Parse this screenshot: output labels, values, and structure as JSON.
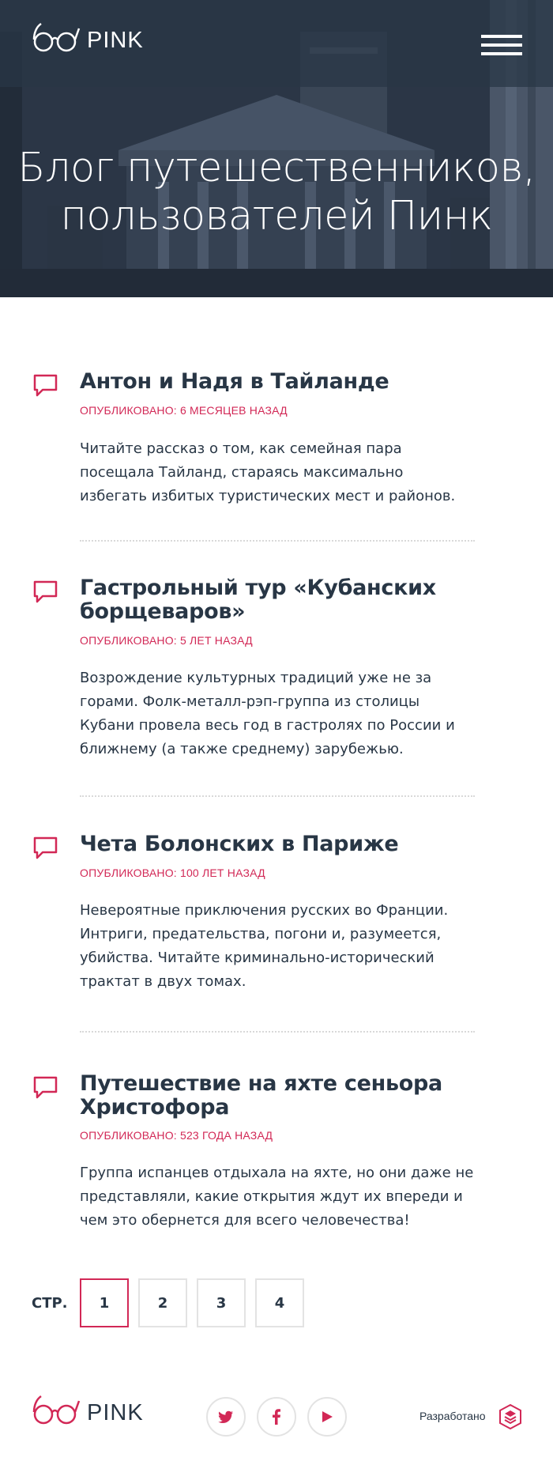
{
  "header": {
    "logo_text": "PINK",
    "title_line1": "Блог путешественников,",
    "title_line2": "пользователей Пинк"
  },
  "posts": [
    {
      "title": "Антон и Надя в Тайланде",
      "date": "ОПУБЛИКОВАНО: 6 МЕСЯЦЕВ НАЗАД",
      "text": "Читайте рассказ о том, как семейная пара посещала Тайланд, стараясь максимально избегать избитых туристических мест и районов."
    },
    {
      "title": "Гастрольный тур «Кубанских борщеваров»",
      "date": "ОПУБЛИКОВАНО: 5 ЛЕТ НАЗАД",
      "text": "Возрождение культурных традиций уже не за горами. Фолк-металл-рэп-группа из столицы Кубани провела весь год в гастролях по России и ближнему (а также среднему) зарубежью."
    },
    {
      "title": "Чета Болонских в Париже",
      "date": "ОПУБЛИКОВАНО: 100 ЛЕТ НАЗАД",
      "text": "Невероятные приключения русских во Франции. Интриги, предательства, погони и, разумеется, убийства. Читайте криминально-исторический трактат в двух томах."
    },
    {
      "title": "Путешествие на яхте сеньора Христофора",
      "date": "ОПУБЛИКОВАНО: 523 ГОДА НАЗАД",
      "text": "Группа испанцев отдыхала на яхте, но они даже не представляли, какие открытия ждут их впереди и чем это обернется для всего человечества!"
    }
  ],
  "pagination": {
    "label": "СТР.",
    "pages": [
      "1",
      "2",
      "3",
      "4"
    ],
    "current": "1"
  },
  "footer": {
    "logo_text": "PINK",
    "developer_label": "Разработано",
    "social": [
      "twitter-icon",
      "facebook-icon",
      "youtube-icon"
    ]
  },
  "colors": {
    "accent": "#d22856",
    "text": "#283645",
    "hero_overlay": "#283645"
  }
}
